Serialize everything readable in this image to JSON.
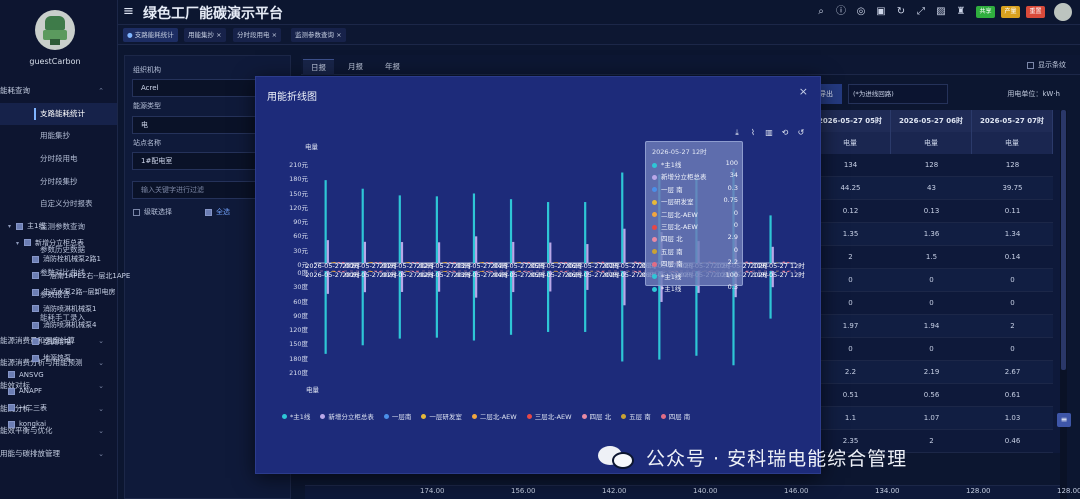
{
  "app": {
    "title": "绿色工厂能碳演示平台",
    "username": "guestCarbon",
    "header_buttons": [
      {
        "label": "共享",
        "color": "#2fae3e"
      },
      {
        "label": "产量",
        "color": "#d9a11e"
      },
      {
        "label": "重置",
        "color": "#d94a3a"
      }
    ]
  },
  "sidebar": {
    "items": [
      {
        "label": "能耗查询",
        "type": "group",
        "expanded": true
      },
      {
        "label": "支路能耗统计",
        "type": "sub",
        "active": true
      },
      {
        "label": "用能集抄",
        "type": "sub"
      },
      {
        "label": "分时段用电",
        "type": "sub"
      },
      {
        "label": "分时段集抄",
        "type": "sub"
      },
      {
        "label": "自定义分时报表",
        "type": "sub"
      },
      {
        "label": "监测参数查询",
        "type": "sub"
      },
      {
        "label": "参数历史数据",
        "type": "sub"
      },
      {
        "label": "参数对比曲线",
        "type": "sub"
      },
      {
        "label": "参数报告",
        "type": "sub"
      },
      {
        "label": "能耗手工录入",
        "type": "sub"
      },
      {
        "label": "能源消费量和强度计算",
        "type": "group"
      },
      {
        "label": "能源消费分析与用能预测",
        "type": "group"
      },
      {
        "label": "能效对标",
        "type": "group"
      },
      {
        "label": "能流分析",
        "type": "group"
      },
      {
        "label": "能效平衡与优化",
        "type": "group"
      },
      {
        "label": "用能与碳排放管理",
        "type": "group"
      }
    ]
  },
  "tabs": [
    "支路能耗统计",
    "用能集抄",
    "分时段用电",
    "监测参数查询"
  ],
  "filters": {
    "org_label": "组织机构",
    "org_value": "Acrel",
    "energy_label": "能源类型",
    "energy_value": "电",
    "station_label": "站点名称",
    "station_value": "1#配电室",
    "search_placeholder": "输入关键字进行过滤",
    "cascade_label": "级联选择",
    "selectall_label": "全选"
  },
  "tree": [
    {
      "label": "主1线",
      "level": 0,
      "expand": true
    },
    {
      "label": "新增分立柜总表",
      "level": 1,
      "expand": true
    },
    {
      "label": "消防栓机械泵2路1",
      "level": 2
    },
    {
      "label": "一层南1APE2右--层北1APE",
      "level": 2
    },
    {
      "label": "生活水泵2路--层卸电房",
      "level": 2
    },
    {
      "label": "消防喷淋机械泵1",
      "level": 2
    },
    {
      "label": "消防喷淋机械泵4",
      "level": 2
    },
    {
      "label": "空调用电",
      "level": 2
    },
    {
      "label": "地源热泵",
      "level": 2
    },
    {
      "label": "ANSVG",
      "level": 0
    },
    {
      "label": "ANAPF",
      "level": 0
    },
    {
      "label": "一二三表",
      "level": 0
    },
    {
      "label": "kongkai",
      "level": 0
    }
  ],
  "report_tabs": {
    "items": [
      "日报",
      "月报",
      "年报"
    ],
    "show_all": "显示条纹"
  },
  "toolbar": {
    "export_label": "导出",
    "column_hint": "(*为进线回路)",
    "unit_label": "用电单位：kW·h"
  },
  "table": {
    "headers": [
      "2026-05-27 05时",
      "2026-05-27 06时",
      "2026-05-27 07时"
    ],
    "subheaders": [
      "电量",
      "电量",
      "电量"
    ],
    "rows": [
      [
        "134",
        "128",
        "128"
      ],
      [
        "44.25",
        "43",
        "39.75"
      ],
      [
        "0.12",
        "0.13",
        "0.11"
      ],
      [
        "1.35",
        "1.36",
        "1.34"
      ],
      [
        "2",
        "1.5",
        "0.14"
      ],
      [
        "0",
        "0",
        "0"
      ],
      [
        "0",
        "0",
        "0"
      ],
      [
        "1.97",
        "1.94",
        "2"
      ],
      [
        "0",
        "0",
        "0"
      ],
      [
        "2.2",
        "2.19",
        "2.67"
      ],
      [
        "0.51",
        "0.56",
        "0.61"
      ],
      [
        "1.1",
        "1.07",
        "1.03"
      ],
      [
        "2.35",
        "2",
        "0.46"
      ]
    ],
    "bottom": [
      "174.00",
      "156.00",
      "142.00",
      "140.00",
      "146.00",
      "134.00",
      "128.00",
      "128.00"
    ]
  },
  "modal": {
    "title": "用能折线图",
    "close": "×"
  },
  "chart_data": {
    "type": "bar",
    "ylabel": "电量",
    "xlabel": "电量",
    "ylim": [
      -210,
      210
    ],
    "yticks_top": [
      "210元",
      "180元",
      "150元",
      "120元",
      "90元",
      "60元",
      "30元",
      "0元"
    ],
    "yticks_bottom": [
      "0度",
      "30度",
      "60度",
      "90度",
      "120度",
      "150度",
      "180度",
      "210度"
    ],
    "categories": [
      "2026-05-27 00时",
      "2026-05-27 01时",
      "2026-05-27 02时",
      "2026-05-27 03时",
      "2026-05-27 04时",
      "2026-05-27 05时",
      "2026-05-27 06时",
      "2026-05-27 07时",
      "2026-05-27 08时",
      "2026-05-27 09时",
      "2026-05-27 10时",
      "2026-05-27 11时",
      "2026-05-27 12时"
    ],
    "series": [
      {
        "name": "*主1线",
        "color": "#2ec6d6",
        "values": [
          174,
          156,
          142,
          140,
          146,
          134,
          128,
          128,
          190,
          186,
          178,
          198,
          100
        ]
      },
      {
        "name": "新增分立柜总表",
        "color": "#b9a7e8",
        "values": [
          48,
          44.5,
          44,
          43.5,
          56,
          44.25,
          43,
          39.75,
          72,
          65,
          46,
          55,
          34
        ]
      },
      {
        "name": "一层南",
        "color": "#4b8fe8",
        "values": [
          0.12,
          0.12,
          0.12,
          0.12,
          0.12,
          0.12,
          0.13,
          0.11,
          0.3,
          0.3,
          0.3,
          0.3,
          0.3
        ]
      },
      {
        "name": "一层研发室",
        "color": "#e6b93a",
        "values": [
          1.35,
          1.35,
          1.35,
          1.35,
          1.35,
          1.35,
          1.36,
          1.34,
          0.75,
          0.75,
          0.75,
          0.75,
          0.75
        ]
      },
      {
        "name": "二层北-AEW",
        "color": "#f0a640",
        "values": [
          2,
          2,
          2,
          2,
          2,
          2,
          1.5,
          0.14,
          0,
          0,
          0,
          0,
          0
        ]
      },
      {
        "name": "三层北-AEW",
        "color": "#e54848",
        "values": [
          0,
          0,
          0,
          0,
          0,
          0,
          0,
          0,
          0,
          0,
          0,
          0,
          0
        ]
      },
      {
        "name": "四层 北",
        "color": "#e88aa4",
        "values": [
          1.97,
          1.97,
          1.97,
          1.97,
          1.97,
          1.97,
          1.94,
          2,
          2.9,
          2.9,
          2.9,
          2.9,
          2.9
        ]
      },
      {
        "name": "五层 南",
        "color": "#c9a233",
        "values": [
          0,
          0,
          0,
          0,
          0,
          0,
          0,
          0,
          0,
          0,
          0,
          0,
          0
        ]
      },
      {
        "name": "四层 南",
        "color": "#e06d86",
        "values": [
          2.2,
          2.2,
          2.2,
          2.2,
          2.2,
          2.2,
          2.19,
          2.67,
          2.2,
          2.2,
          2.2,
          2.2,
          2.2
        ]
      }
    ],
    "tooltip": {
      "title": "2026-05-27 12时",
      "rows": [
        {
          "name": "*主1线",
          "value": "100",
          "color": "#2ec6d6"
        },
        {
          "name": "新增分立柜总表",
          "value": "34",
          "color": "#b9a7e8"
        },
        {
          "name": "一层 南",
          "value": "0.3",
          "color": "#4b8fe8"
        },
        {
          "name": "一层研发室",
          "value": "0.75",
          "color": "#e6b93a"
        },
        {
          "name": "二层北-AEW",
          "value": "0",
          "color": "#f0a640"
        },
        {
          "name": "三层北-AEW",
          "value": "0",
          "color": "#e54848"
        },
        {
          "name": "四层 北",
          "value": "2.9",
          "color": "#e88aa4"
        },
        {
          "name": "五层 南",
          "value": "0",
          "color": "#c9a233"
        },
        {
          "name": "四层 南",
          "value": "2.2",
          "color": "#e06d86"
        },
        {
          "name": "*主1线",
          "value": "100",
          "color": "#2ec6d6"
        },
        {
          "name": "*主1线",
          "value": "0.3",
          "color": "#2ec6d6"
        }
      ]
    }
  },
  "watermark": "公众号 · 安科瑞电能综合管理"
}
